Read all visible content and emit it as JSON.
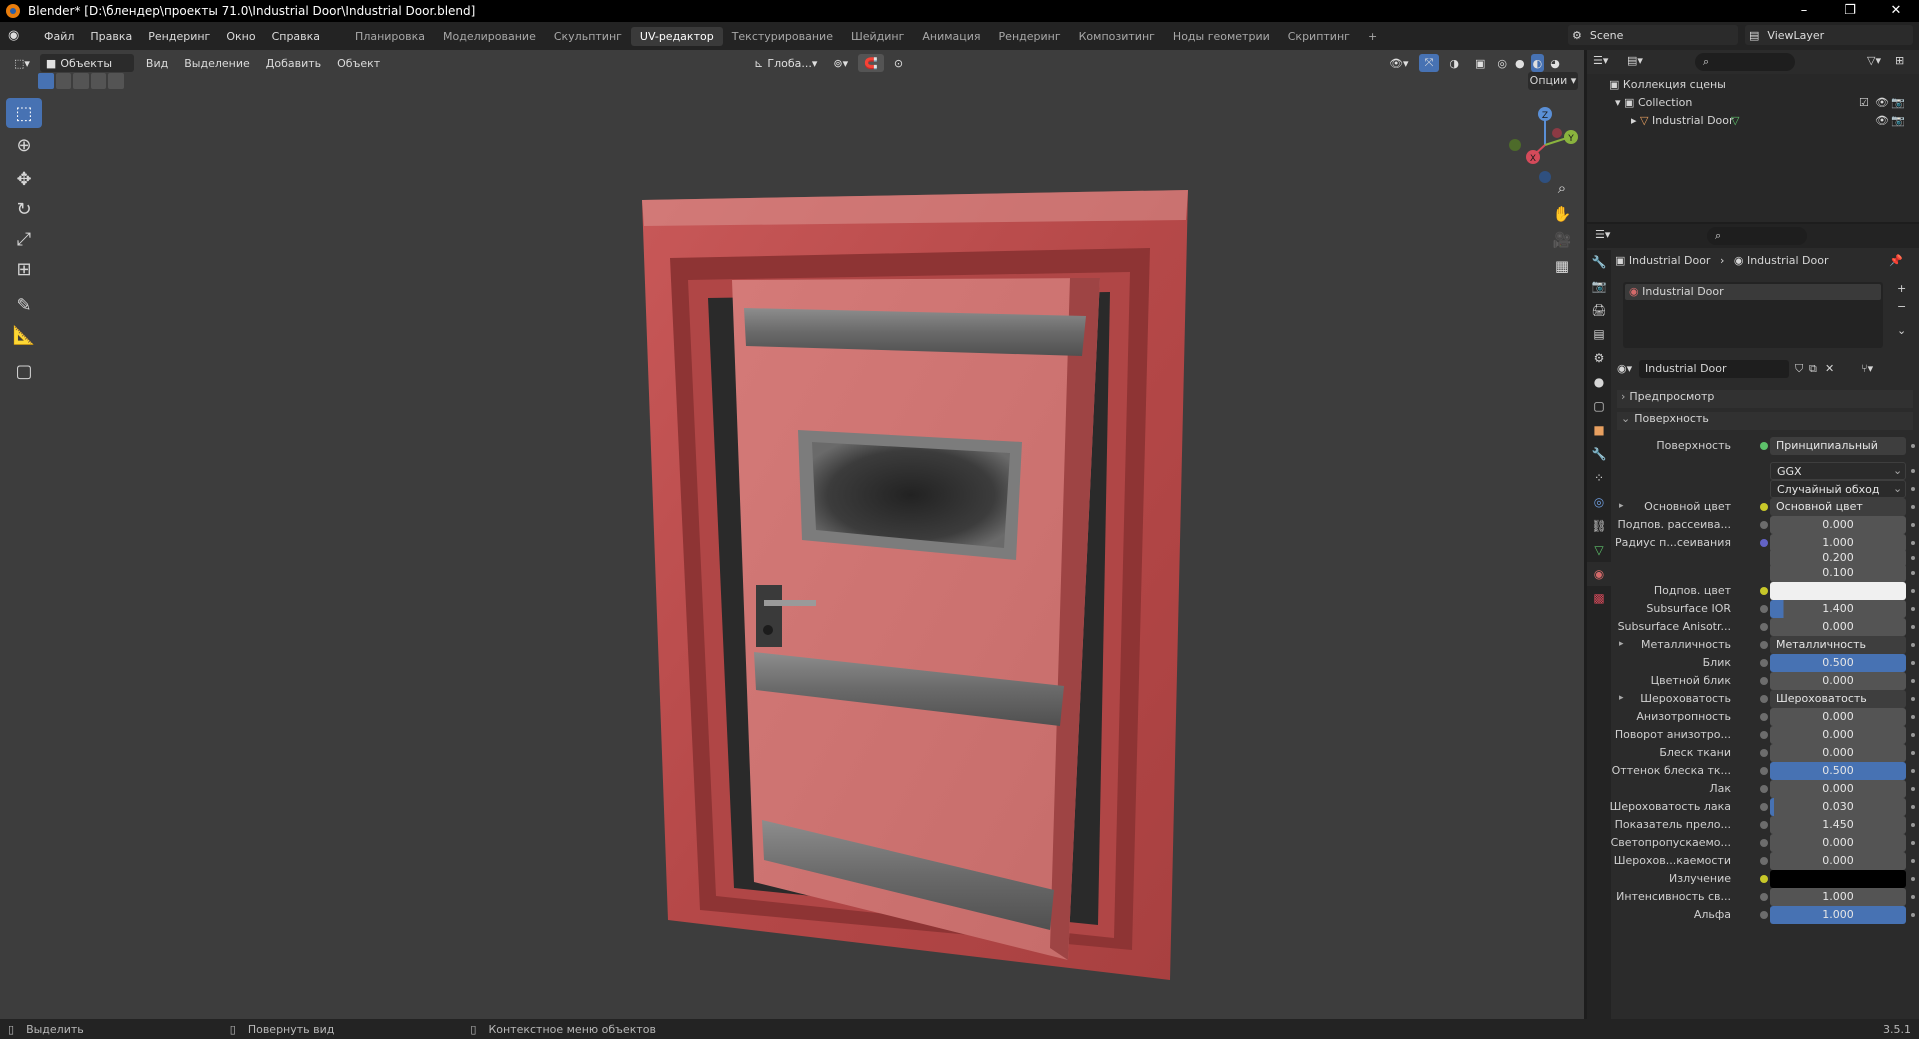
{
  "titlebar": {
    "title": "Blender* [D:\\блендер\\проекты 71.0\\Industrial Door\\Industrial Door.blend]"
  },
  "menu": {
    "items": [
      "Файл",
      "Правка",
      "Рендеринг",
      "Окно",
      "Справка"
    ]
  },
  "workspaces": {
    "tabs": [
      "Планировка",
      "Моделирование",
      "Скульптинг",
      "UV-редактор",
      "Текстурирование",
      "Шейдинг",
      "Анимация",
      "Рендеринг",
      "Композитинг",
      "Ноды геометрии",
      "Скриптинг"
    ],
    "active": "UV-редактор",
    "add": "+"
  },
  "scene": {
    "name": "Scene",
    "view_layer": "ViewLayer"
  },
  "viewport": {
    "mode": "Объекты",
    "menus": [
      "Вид",
      "Выделение",
      "Добавить",
      "Объект"
    ],
    "orientation": "Глоба...",
    "options": "Опции",
    "gizmo": {
      "x": "X",
      "y": "Y",
      "z": "Z"
    }
  },
  "outliner": {
    "root": "Коллекция сцены",
    "collection": "Collection",
    "object": "Industrial Door"
  },
  "properties": {
    "breadcrumb_object": "Industrial Door",
    "breadcrumb_material": "Industrial Door",
    "slot": "Industrial Door",
    "material_name": "Industrial Door",
    "preview": "Предпросмотр",
    "surface_panel": "Поверхность",
    "rows": [
      {
        "label": "Поверхность",
        "value": "Принципиальный BSDF",
        "dot": "green",
        "kind": "link"
      },
      {
        "label": "",
        "value": "GGX",
        "kind": "dropdown"
      },
      {
        "label": "",
        "value": "Случайный обход",
        "kind": "dropdown"
      },
      {
        "label": "Основной цвет",
        "value": "Основной цвет",
        "dot": "y",
        "kind": "link",
        "expand": true
      },
      {
        "label": "Подпов. рассеива...",
        "value": "0.000",
        "kind": "num"
      },
      {
        "label": "Радиус п...сеивания",
        "value": "1.000",
        "dot": "b",
        "kind": "num"
      },
      {
        "label": "",
        "value": "0.200",
        "kind": "num",
        "nodot": true
      },
      {
        "label": "",
        "value": "0.100",
        "kind": "num",
        "nodot": true
      },
      {
        "label": "Подпов. цвет",
        "value": "",
        "dot": "y",
        "kind": "white"
      },
      {
        "label": "Subsurface IOR",
        "value": "1.400",
        "kind": "num",
        "fill": 0.1
      },
      {
        "label": "Subsurface Anisotr...",
        "value": "0.000",
        "kind": "num"
      },
      {
        "label": "Металличность",
        "value": "Металличность",
        "kind": "link",
        "expand": true
      },
      {
        "label": "Блик",
        "value": "0.500",
        "kind": "blue"
      },
      {
        "label": "Цветной блик",
        "value": "0.000",
        "kind": "num"
      },
      {
        "label": "Шероховатость",
        "value": "Шероховатость",
        "kind": "link",
        "expand": true
      },
      {
        "label": "Анизотропность",
        "value": "0.000",
        "kind": "num"
      },
      {
        "label": "Поворот анизотро...",
        "value": "0.000",
        "kind": "num"
      },
      {
        "label": "Блеск ткани",
        "value": "0.000",
        "kind": "num"
      },
      {
        "label": "Оттенок блеска тк...",
        "value": "0.500",
        "kind": "blue"
      },
      {
        "label": "Лак",
        "value": "0.000",
        "kind": "num"
      },
      {
        "label": "Шероховатость лака",
        "value": "0.030",
        "kind": "num",
        "fill": 0.03
      },
      {
        "label": "Показатель прело...",
        "value": "1.450",
        "kind": "num"
      },
      {
        "label": "Светопропускаемо...",
        "value": "0.000",
        "kind": "num"
      },
      {
        "label": "Шерохов...каемости",
        "value": "0.000",
        "kind": "num"
      },
      {
        "label": "Излучение",
        "value": "",
        "dot": "y",
        "kind": "black"
      },
      {
        "label": "Интенсивность св...",
        "value": "1.000",
        "kind": "num"
      },
      {
        "label": "Альфа",
        "value": "1.000",
        "kind": "blue"
      }
    ]
  },
  "status": {
    "select": "Выделить",
    "rotate": "Повернуть вид",
    "context": "Контекстное меню объектов",
    "version": "3.5.1"
  }
}
